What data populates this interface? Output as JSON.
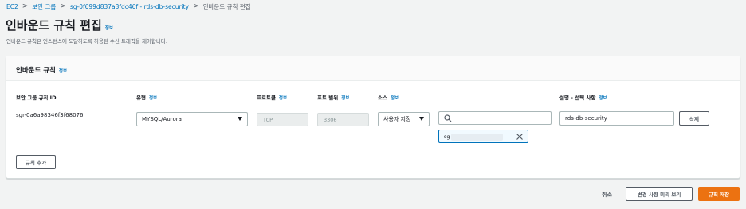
{
  "breadcrumb": {
    "items": [
      "EC2",
      "보안 그룹",
      "sg-0f699d837a3fdc46f - rds-db-security"
    ],
    "current": "인바운드 규칙 편집",
    "separator": ">"
  },
  "page": {
    "title": "인바운드 규칙 편집",
    "info": "정보",
    "description": "인바운드 규칙은 인스턴스에 도달하도록 허용된 수신 트래픽을 제어합니다."
  },
  "panel": {
    "title": "인바운드 규칙",
    "info": "정보",
    "columns": {
      "rule_id": "보안 그룹 규칙 ID",
      "type": "유형",
      "protocol": "프로토콜",
      "port_range": "포트 범위",
      "source": "소스",
      "description": "설명 - 선택 사항",
      "info": "정보"
    },
    "rule": {
      "id": "sgr-0a6a98346f3f68076",
      "type": "MYSQL/Aurora",
      "protocol": "TCP",
      "port_range": "3306",
      "source_type": "사용자 지정",
      "source_search": "",
      "source_token": "sg-",
      "description": "rds-db-security",
      "delete_label": "삭제"
    },
    "add_rule_label": "규칙 추가"
  },
  "footer": {
    "cancel_label": "취소",
    "preview_label": "변경 사항 미리 보기",
    "save_label": "규칙 저장"
  },
  "colors": {
    "link": "#0073bb",
    "primary": "#ec7211",
    "background": "#f2f3f3"
  }
}
